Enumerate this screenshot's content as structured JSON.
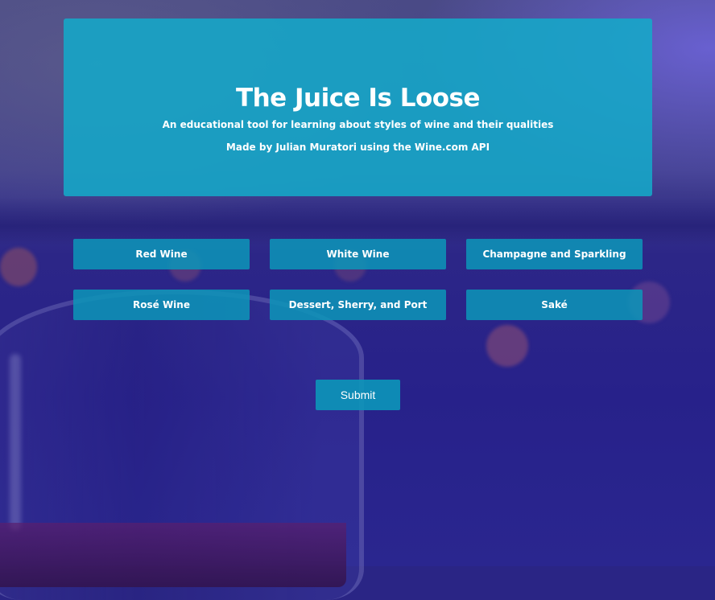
{
  "header": {
    "title": "The Juice Is Loose",
    "subtitle": "An educational tool for learning about styles of wine and their qualities",
    "credit": "Made by Julian Muratori using the Wine.com API"
  },
  "categories": [
    {
      "label": "Red Wine"
    },
    {
      "label": "White Wine"
    },
    {
      "label": "Champagne and Sparkling"
    },
    {
      "label": "Rosé Wine"
    },
    {
      "label": "Dessert, Sherry, and Port"
    },
    {
      "label": "Saké"
    }
  ],
  "submit_label": "Submit",
  "colors": {
    "accent": "#14a8c8",
    "background": "#2a2585"
  }
}
